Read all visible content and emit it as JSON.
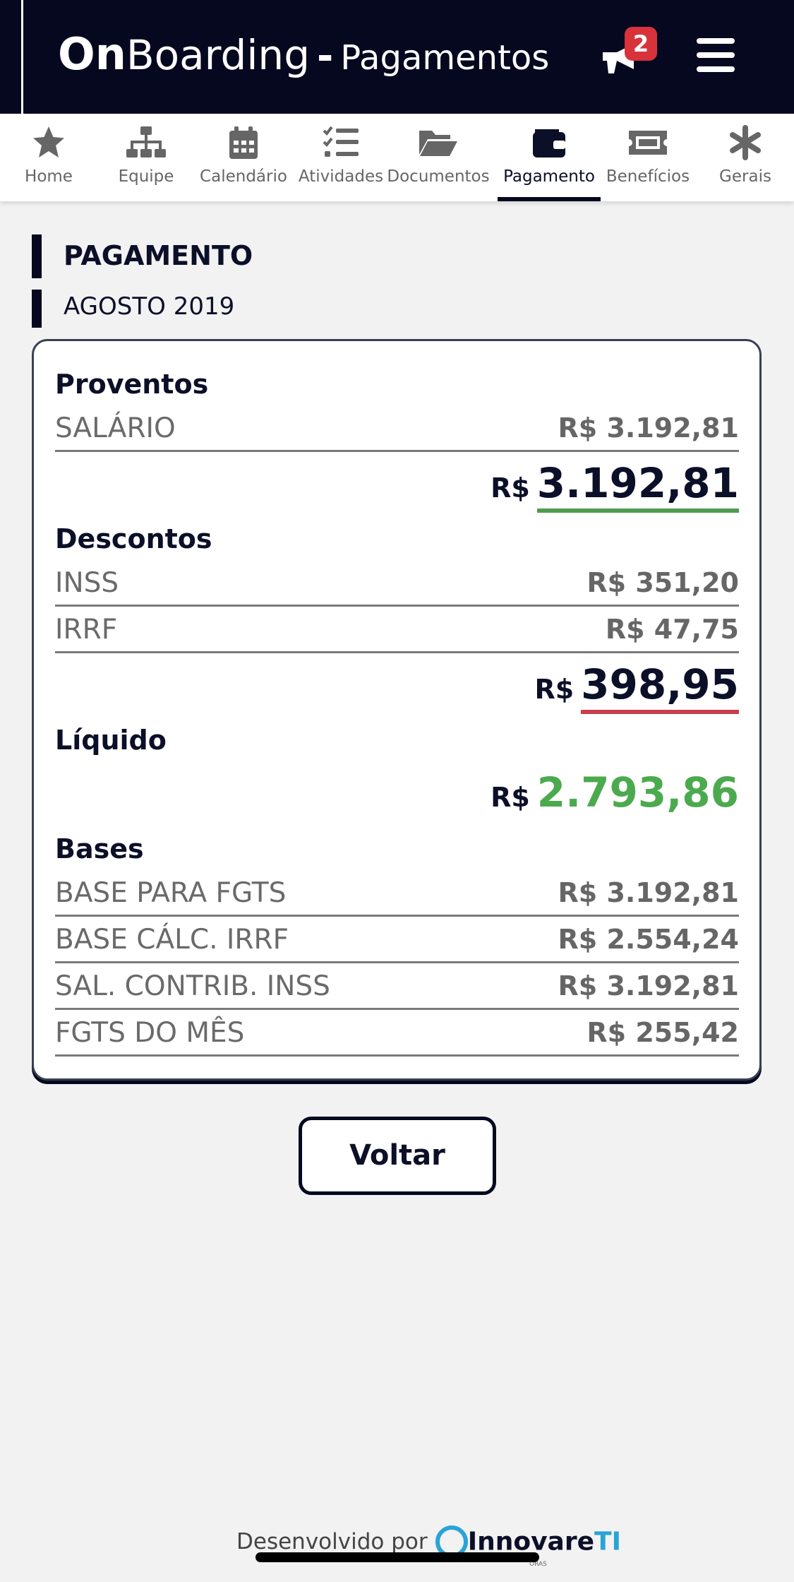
{
  "header": {
    "brand_on": "On",
    "brand_boarding": "Boarding",
    "brand_dash": "-",
    "brand_sub": "Pagamentos",
    "notification_count": "2",
    "icons": {
      "notifications": "megaphone-icon",
      "menu": "hamburger-icon"
    }
  },
  "tabs": [
    {
      "label": "Home",
      "icon": "star-icon"
    },
    {
      "label": "Equipe",
      "icon": "org-chart-icon"
    },
    {
      "label": "Calendário",
      "icon": "calendar-icon"
    },
    {
      "label": "Atividades",
      "icon": "checklist-icon"
    },
    {
      "label": "Documentos",
      "icon": "folder-open-icon"
    },
    {
      "label": "Pagamento",
      "icon": "wallet-icon",
      "active": true
    },
    {
      "label": "Benefícios",
      "icon": "ticket-icon"
    },
    {
      "label": "Gerais",
      "icon": "asterisk-icon"
    }
  ],
  "page": {
    "title": "PAGAMENTO",
    "month": "AGOSTO 2019"
  },
  "payslip": {
    "proventos": {
      "title": "Proventos",
      "items": [
        {
          "label": "SALÁRIO",
          "value": "R$ 3.192,81"
        }
      ],
      "total_currency": "R$",
      "total_value": "3.192,81"
    },
    "descontos": {
      "title": "Descontos",
      "items": [
        {
          "label": "INSS",
          "value": "R$ 351,20"
        },
        {
          "label": "IRRF",
          "value": "R$ 47,75"
        }
      ],
      "total_currency": "R$",
      "total_value": "398,95"
    },
    "liquido": {
      "title": "Líquido",
      "total_currency": "R$",
      "total_value": "2.793,86"
    },
    "bases": {
      "title": "Bases",
      "items": [
        {
          "label": "BASE PARA FGTS",
          "value": "R$ 3.192,81"
        },
        {
          "label": "BASE CÁLC. IRRF",
          "value": "R$ 2.554,24"
        },
        {
          "label": "SAL. CONTRIB. INSS",
          "value": "R$ 3.192,81"
        },
        {
          "label": "FGTS DO MÊS",
          "value": "R$ 255,42"
        }
      ]
    }
  },
  "actions": {
    "back_label": "Voltar"
  },
  "footer": {
    "developed_by": "Desenvolvido por",
    "logo_part1": "Innovare",
    "logo_part2": "TI",
    "logo_small": "ORAS"
  },
  "colors": {
    "primary": "#05081f",
    "positive": "#4caa4e",
    "negative": "#c7414a",
    "badge": "#d8323b",
    "logo_accent": "#2aa3d6"
  }
}
